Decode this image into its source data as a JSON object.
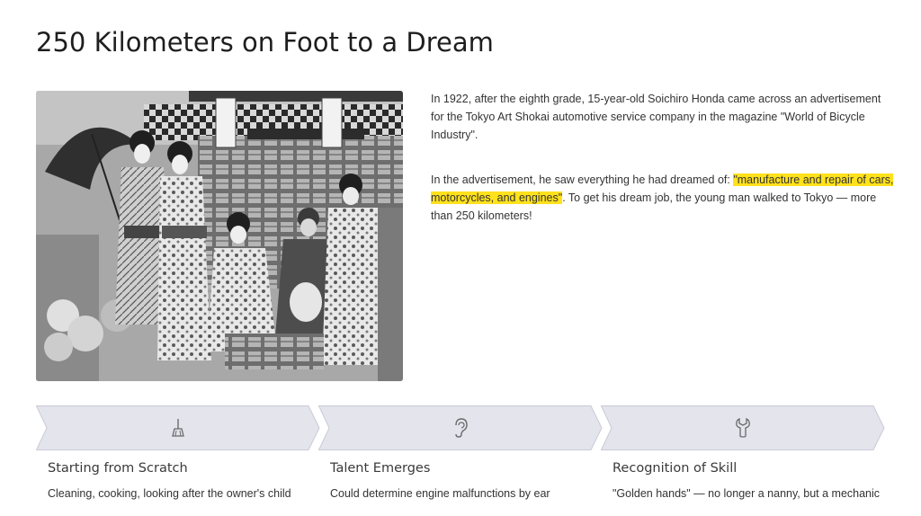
{
  "slide": {
    "title": "250 Kilometers on Foot to a Dream"
  },
  "body": {
    "p1": "In 1922, after the eighth grade, 15-year-old Soichiro Honda came across an advertisement for the Tokyo Art Shokai automotive service company in the magazine \"World of Bicycle Industry\".",
    "p2_before": "In the advertisement, he saw everything he had dreamed of: ",
    "p2_highlight": "\"manufacture and repair of cars, motorcycles, and engines\"",
    "p2_after": ". To get his dream job, the young man walked to Tokyo — more than 250 kilometers!"
  },
  "steps": [
    {
      "icon": "broom-icon",
      "title": "Starting from Scratch",
      "description": "Cleaning, cooking, looking after the owner's child"
    },
    {
      "icon": "ear-icon",
      "title": "Talent Emerges",
      "description": "Could determine engine malfunctions by ear"
    },
    {
      "icon": "wrench-icon",
      "title": "Recognition of Skill",
      "description": "\"Golden hands\" — no longer a nanny, but a mechanic"
    }
  ],
  "colors": {
    "highlight": "#ffe11c",
    "chevron_fill": "#e3e4ec",
    "chevron_stroke": "#c9cad6",
    "icon_stroke": "#6a6a6a"
  }
}
